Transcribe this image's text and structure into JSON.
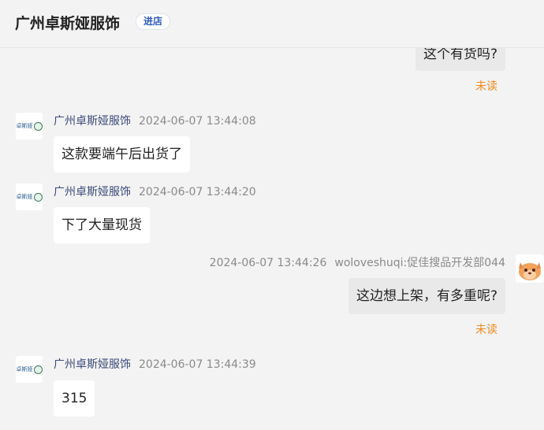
{
  "header": {
    "shop_name": "广州卓斯娅服饰",
    "enter_label": "进店"
  },
  "shop_avatar_text": "卓斯娅",
  "messages": [
    {
      "text": "这个有货吗?",
      "status": "未读"
    },
    {
      "sender": "广州卓斯娅服饰",
      "time": "2024-06-07 13:44:08",
      "text": "这款要端午后出货了"
    },
    {
      "sender": "广州卓斯娅服饰",
      "time": "2024-06-07 13:44:20",
      "text": "下了大量现货"
    },
    {
      "time": "2024-06-07 13:44:26",
      "sender": "woloveshuqi:促佳搜品开发部044",
      "text": "这边想上架，有多重呢?",
      "status": "未读"
    },
    {
      "sender": "广州卓斯娅服饰",
      "time": "2024-06-07 13:44:39",
      "text": "315"
    }
  ],
  "colors": {
    "unread": "#f08a1c",
    "sender": "#3b4a7a",
    "enter_button_text": "#2b5bb8"
  }
}
